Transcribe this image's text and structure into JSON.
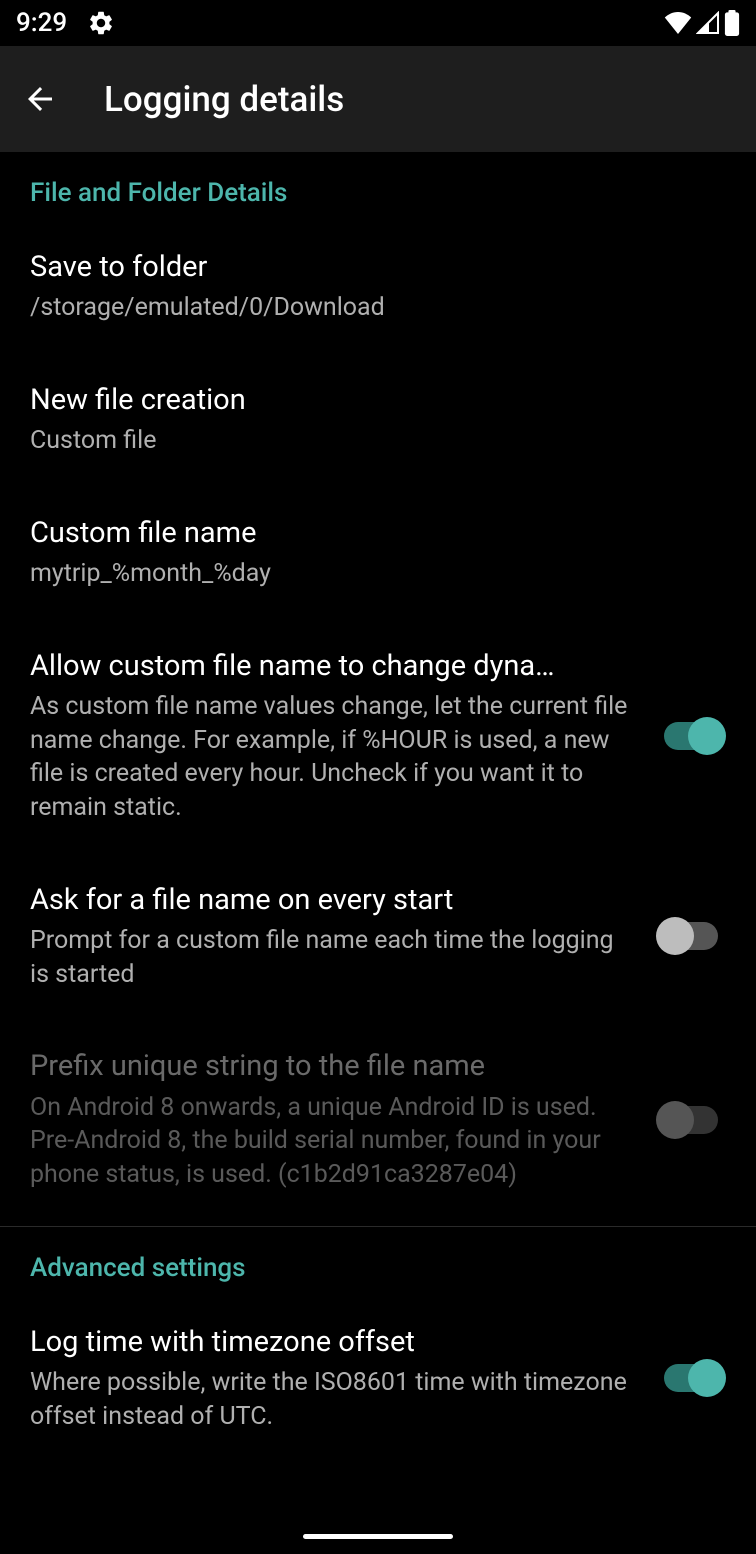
{
  "status": {
    "time": "9:29"
  },
  "appbar": {
    "title": "Logging details"
  },
  "sections": {
    "file_folder": {
      "header": "File and Folder Details",
      "save_folder": {
        "title": "Save to folder",
        "summary": "/storage/emulated/0/Download"
      },
      "new_file": {
        "title": "New file creation",
        "summary": "Custom file"
      },
      "custom_name": {
        "title": "Custom file name",
        "summary": "mytrip_%month_%day"
      },
      "dynamic_name": {
        "title": "Allow custom file name to change dyna…",
        "summary": "As custom file name values change, let the current file name change. For example, if %HOUR is used, a new file is created every hour. Uncheck if you want it to remain static."
      },
      "ask_name": {
        "title": "Ask for a file name on every start",
        "summary": "Prompt for a custom file name each time the logging is started"
      },
      "prefix_unique": {
        "title": "Prefix unique string to the file name",
        "summary": "On Android 8 onwards, a unique Android ID is used. Pre-Android 8, the build serial number, found in your phone status, is used. (c1b2d91ca3287e04)"
      }
    },
    "advanced": {
      "header": "Advanced settings",
      "tz_offset": {
        "title": "Log time with timezone offset",
        "summary": "Where possible, write the ISO8601 time with timezone offset instead of UTC."
      }
    }
  }
}
